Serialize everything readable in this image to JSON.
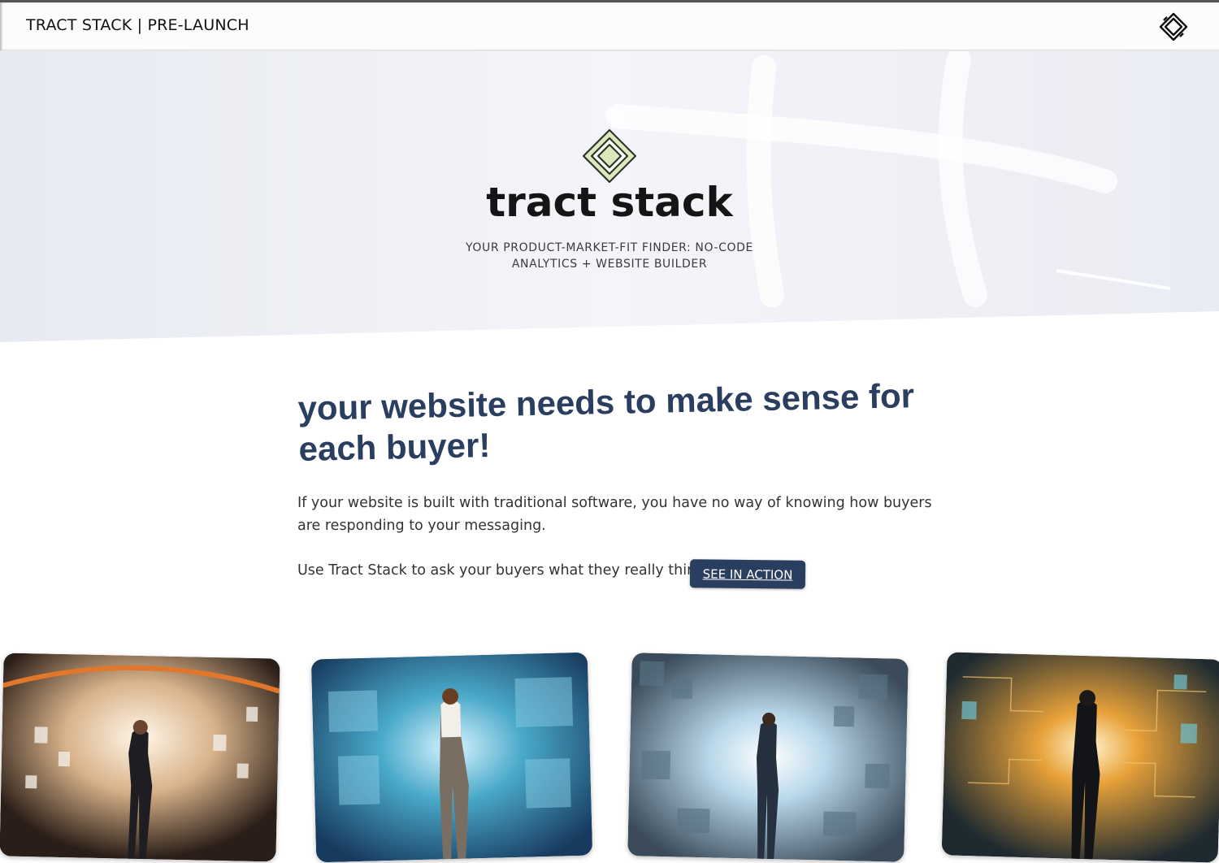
{
  "header": {
    "title": "TRACT STACK | PRE-LAUNCH",
    "logo_icon": "tractstack-logo-icon"
  },
  "hero": {
    "logo_icon": "tractstack-logo-icon",
    "wordmark": "tract stack",
    "tagline": "YOUR PRODUCT-MARKET-FIT FINDER: NO-CODE ANALYTICS + WEBSITE BUILDER"
  },
  "main": {
    "headline": "your website needs to make sense for each buyer!",
    "paragraph": "If your website is built with traditional software, you have no way of knowing how buyers are responding to your messaging.",
    "cta_text": "Use Tract Stack to ask your buyers what they really think",
    "cta_button": "SEE IN ACTION"
  },
  "cards": [
    {
      "icon": "woman-with-tablet-in-data-tunnel-image",
      "accent": "#e0772c"
    },
    {
      "icon": "woman-facing-blue-screens-image",
      "accent": "#3fa6c9"
    },
    {
      "icon": "man-in-pixel-tunnel-image",
      "accent": "#6fa6c8"
    },
    {
      "icon": "man-in-golden-circuit-tunnel-image",
      "accent": "#e8a23a"
    }
  ],
  "colors": {
    "primary": "#2a3f5f",
    "logo_fill": "#dbe8b8",
    "hero_bg": "#eef0f5"
  }
}
